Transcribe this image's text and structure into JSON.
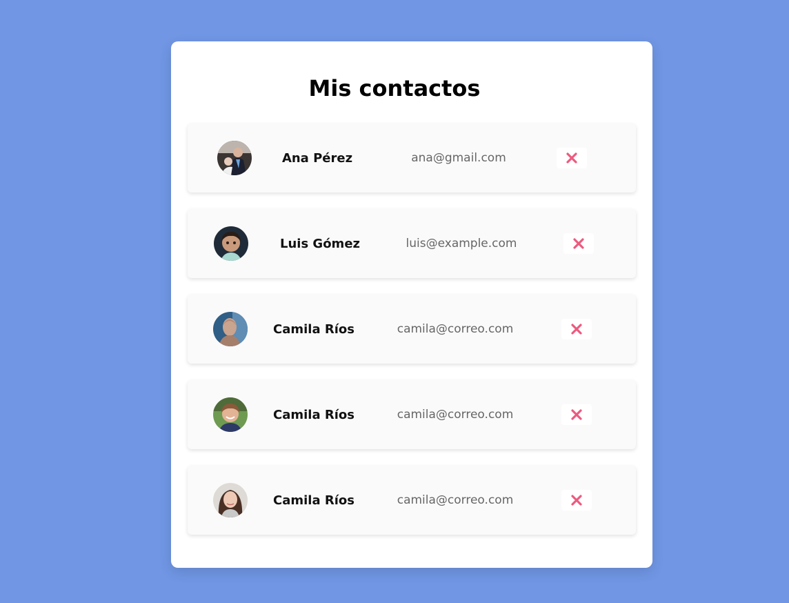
{
  "page": {
    "title": "Mis contactos",
    "background": "#7096e4",
    "accent_delete": "#ec5a7e"
  },
  "contacts": [
    {
      "name": "Ana Pérez",
      "email": "ana@gmail.com",
      "avatar": "photo-man-with-child",
      "delete_icon": "x-icon"
    },
    {
      "name": "Luis Gómez",
      "email": "luis@example.com",
      "avatar": "photo-toddler",
      "delete_icon": "x-icon"
    },
    {
      "name": "Camila Ríos",
      "email": "camila@correo.com",
      "avatar": "photo-bald-man",
      "delete_icon": "x-icon"
    },
    {
      "name": "Camila Ríos",
      "email": "camila@correo.com",
      "avatar": "photo-boy-smiling",
      "delete_icon": "x-icon"
    },
    {
      "name": "Camila Ríos",
      "email": "camila@correo.com",
      "avatar": "photo-young-woman",
      "delete_icon": "x-icon"
    }
  ]
}
